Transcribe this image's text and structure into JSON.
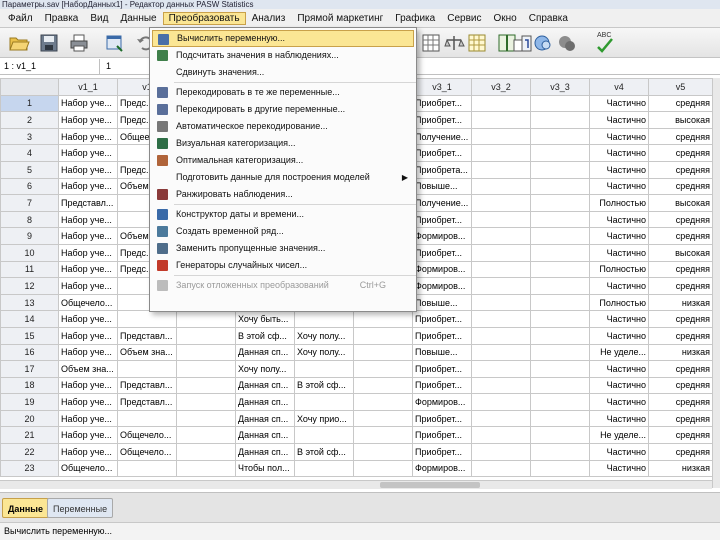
{
  "window": {
    "title": "Параметры.sav [НаборДанных1] - Редактор данных PASW Statistics"
  },
  "menubar": [
    "Файл",
    "Правка",
    "Вид",
    "Данные",
    "Преобразовать",
    "Анализ",
    "Прямой маркетинг",
    "Графика",
    "Сервис",
    "Окно",
    "Справка"
  ],
  "toolbar": {
    "icons": [
      "open-icon",
      "save-icon",
      "print-icon",
      "dialog-recall-icon",
      "undo-icon",
      "goto-case-icon",
      "variables-icon",
      "find-icon",
      "split-file-icon",
      "weight-cases-icon",
      "select-cases-icon",
      "value-labels-icon",
      "use-sets-icon",
      "show-all-icon",
      "spelling-icon"
    ],
    "spelling_label": "ABC"
  },
  "cell_editor": {
    "ref": "1 : v1_1",
    "value": "1"
  },
  "grid": {
    "columns": [
      "",
      "v1_1",
      "v1",
      "",
      "",
      "",
      "",
      "v3_1",
      "v3_2",
      "v3_3",
      "v4",
      "v5"
    ],
    "rows": [
      [
        "1",
        "Набор уче...",
        "Предс...",
        "",
        "",
        "",
        "",
        "Приобрет...",
        "",
        "",
        "Частично",
        "средняя"
      ],
      [
        "2",
        "Набор уче...",
        "Предс...",
        "",
        "",
        "",
        "",
        "Приобрет...",
        "",
        "",
        "Частично",
        "высокая"
      ],
      [
        "3",
        "Набор уче...",
        "Общее...",
        "",
        "",
        "",
        "",
        "Получение...",
        "",
        "",
        "Частично",
        "средняя"
      ],
      [
        "4",
        "Набор уче...",
        "",
        "",
        "",
        "",
        "",
        "Приобрет...",
        "",
        "",
        "Частично",
        "средняя"
      ],
      [
        "5",
        "Набор уче...",
        "Предс...",
        "",
        "",
        "",
        "",
        "Приобрета...",
        "",
        "",
        "Частично",
        "средняя"
      ],
      [
        "6",
        "Набор уче...",
        "Объем...",
        "",
        "",
        "",
        "",
        "Повыше...",
        "",
        "",
        "Частично",
        "средняя"
      ],
      [
        "7",
        "Представл...",
        "",
        "",
        "",
        "",
        "",
        "Получение...",
        "",
        "",
        "Полностью",
        "высокая"
      ],
      [
        "8",
        "Набор уче...",
        "",
        "",
        "",
        "",
        "",
        "Приобрет...",
        "",
        "",
        "Частично",
        "средняя"
      ],
      [
        "9",
        "Набор уче...",
        "Объем...",
        "",
        "",
        "",
        "",
        "Формиров...",
        "",
        "",
        "Частично",
        "средняя"
      ],
      [
        "10",
        "Набор уче...",
        "Предс...",
        "",
        "",
        "",
        "",
        "Приобрет...",
        "",
        "",
        "Частично",
        "высокая"
      ],
      [
        "11",
        "Набор уче...",
        "Предс...",
        "",
        "",
        "",
        "",
        "Формиров...",
        "",
        "",
        "Полностью",
        "средняя"
      ],
      [
        "12",
        "Набор уче...",
        "",
        "",
        "",
        "",
        "",
        "Формиров...",
        "",
        "",
        "Частично",
        "средняя"
      ],
      [
        "13",
        "Общечело...",
        "",
        "",
        "",
        "",
        "",
        "Повыше...",
        "",
        "",
        "Полностью",
        "низкая"
      ],
      [
        "14",
        "Набор уче...",
        "",
        "",
        "Хочу быть...",
        "",
        "",
        "Приобрет...",
        "",
        "",
        "Частично",
        "средняя"
      ],
      [
        "15",
        "Набор уче...",
        "Представл...",
        "",
        "В этой сф...",
        "Хочу полу...",
        "",
        "Приобрет...",
        "",
        "",
        "Частично",
        "средняя"
      ],
      [
        "16",
        "Набор уче...",
        "Объем зна...",
        "",
        "Данная сп...",
        "Хочу полу...",
        "",
        "Повыше...",
        "",
        "",
        "Не уделе...",
        "низкая"
      ],
      [
        "17",
        "Объем зна...",
        "",
        "",
        "Хочу полу...",
        "",
        "",
        "Приобрет...",
        "",
        "",
        "Частично",
        "средняя"
      ],
      [
        "18",
        "Набор уче...",
        "Представл...",
        "",
        "Данная сп...",
        "В этой сф...",
        "",
        "Приобрет...",
        "",
        "",
        "Частично",
        "средняя"
      ],
      [
        "19",
        "Набор уче...",
        "Представл...",
        "",
        "Данная сп...",
        "",
        "",
        "Формиров...",
        "",
        "",
        "Частично",
        "средняя"
      ],
      [
        "20",
        "Набор уче...",
        "",
        "",
        "Данная сп...",
        "Хочу прио...",
        "",
        "Приобрет...",
        "",
        "",
        "Частично",
        "средняя"
      ],
      [
        "21",
        "Набор уче...",
        "Общечело...",
        "",
        "Данная сп...",
        "",
        "",
        "Приобрет...",
        "",
        "",
        "Не уделе...",
        "средняя"
      ],
      [
        "22",
        "Набор уче...",
        "Общечело...",
        "",
        "Данная сп...",
        "В этой сф...",
        "",
        "Приобрет...",
        "",
        "",
        "Частично",
        "средняя"
      ],
      [
        "23",
        "Общечело...",
        "",
        "",
        "Чтобы пол...",
        "",
        "",
        "Формиров...",
        "",
        "",
        "Частично",
        "низкая"
      ]
    ]
  },
  "dropdown": {
    "items": [
      {
        "label": "Вычислить переменную...",
        "icon": "calculator-icon",
        "highlight": true
      },
      {
        "label": "Подсчитать значения в наблюдениях...",
        "icon": "count-icon"
      },
      {
        "label": "Сдвинуть значения...",
        "icon": ""
      },
      {
        "sep": true
      },
      {
        "label": "Перекодировать в те же переменные...",
        "icon": "recode-same-icon"
      },
      {
        "label": "Перекодировать в другие переменные...",
        "icon": "recode-different-icon"
      },
      {
        "label": "Автоматическое перекодирование...",
        "icon": "auto-recode-icon"
      },
      {
        "label": "Визуальная категоризация...",
        "icon": "visual-binning-icon"
      },
      {
        "label": "Оптимальная категоризация...",
        "icon": "optimal-binning-icon"
      },
      {
        "label": "Подготовить данные для построения моделей",
        "icon": "",
        "submenu": true
      },
      {
        "label": "Ранжировать наблюдения...",
        "icon": "rank-cases-icon"
      },
      {
        "sep": true
      },
      {
        "label": "Конструктор даты и времени...",
        "icon": "date-wizard-icon"
      },
      {
        "label": "Создать временной ряд...",
        "icon": "time-series-icon"
      },
      {
        "label": "Заменить пропущенные значения...",
        "icon": "replace-missing-icon"
      },
      {
        "label": "Генераторы случайных чисел...",
        "icon": "random-generator-icon"
      },
      {
        "sep": true
      },
      {
        "label": "Запуск отложенных преобразований",
        "icon": "run-pending-icon",
        "disabled": true,
        "shortcut": "Ctrl+G"
      }
    ]
  },
  "tabs": {
    "data": "Данные",
    "variables": "Переменные"
  },
  "status": {
    "text": "Вычислить переменную..."
  }
}
